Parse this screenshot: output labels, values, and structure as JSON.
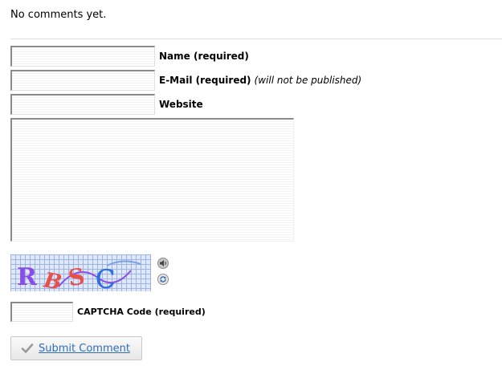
{
  "comments": {
    "empty_text": "No comments yet."
  },
  "form": {
    "name": {
      "label": "Name (required)",
      "value": ""
    },
    "email": {
      "label": "E-Mail (required)",
      "note": "(will not be published)",
      "value": ""
    },
    "website": {
      "label": "Website",
      "value": ""
    },
    "comment": {
      "value": ""
    },
    "captcha": {
      "image_text": "RBSC",
      "label": "CAPTCHA Code (required)",
      "value": "",
      "audio_icon": "speaker-icon",
      "refresh_icon": "refresh-icon"
    },
    "submit": {
      "label": "Submit Comment",
      "icon": "check-icon"
    }
  },
  "colors": {
    "link": "#2f6fb5",
    "captcha_background": "#dfe8f9",
    "captcha_letter_purple": "#8a4ce8",
    "captcha_letter_red": "#e8504a",
    "captcha_letter_blue": "#2f6fe0"
  }
}
